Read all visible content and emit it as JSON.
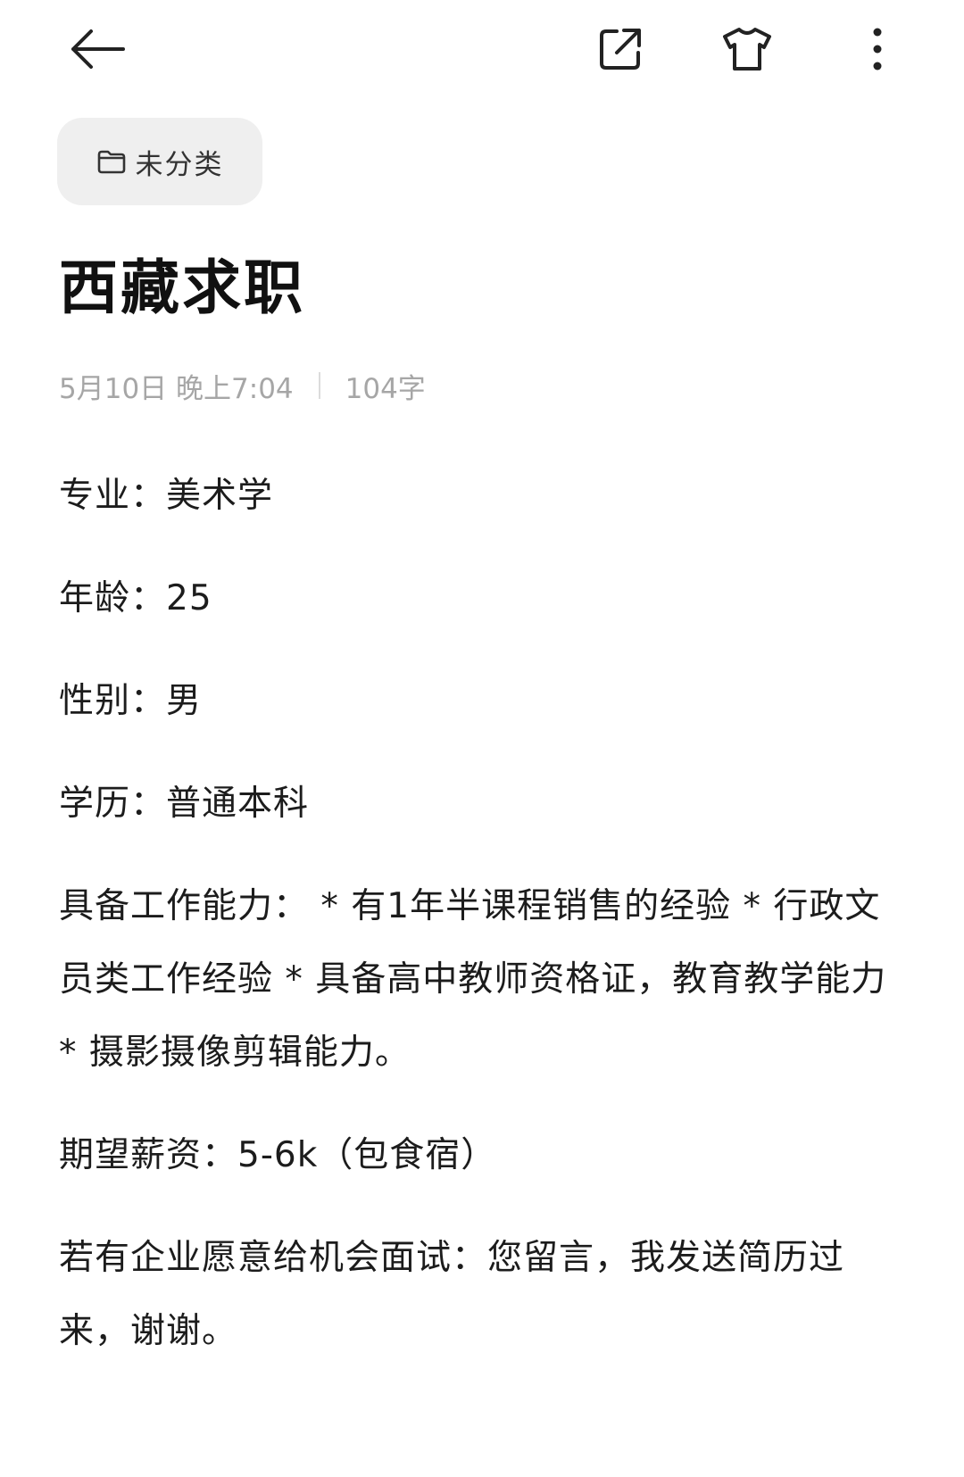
{
  "toolbar": {
    "back_icon": "arrow-left-icon",
    "share_icon": "external-share-icon",
    "skin_icon": "tshirt-icon",
    "more_icon": "more-vertical-icon"
  },
  "category": {
    "icon": "folder-icon",
    "label": "未分类"
  },
  "note": {
    "title": "西藏求职",
    "date": "5月10日 晚上7:04",
    "word_count": "104字",
    "paragraphs": [
      "专业：美术学",
      "年龄：25",
      "性别：男",
      "学历：普通本科",
      "具备工作能力： * 有1年半课程销售的经验 * 行政文员类工作经验 * 具备高中教师资格证，教育教学能力 * 摄影摄像剪辑能力。",
      "期望薪资：5-6k（包食宿）",
      "若有企业愿意给机会面试：您留言，我发送简历过来，谢谢。"
    ]
  },
  "colors": {
    "chip_background": "#efefef",
    "meta_text": "#a6a6a6",
    "body_text": "#1c1c1c"
  }
}
